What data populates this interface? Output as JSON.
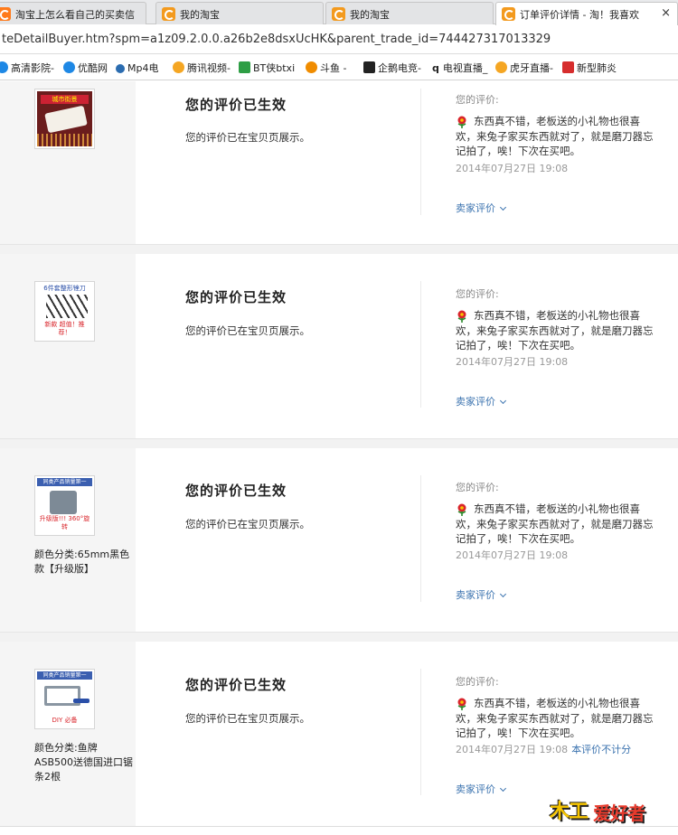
{
  "tabs": [
    {
      "label": "淘宝上怎么看自己的买卖信",
      "active": false
    },
    {
      "label": "我的淘宝",
      "active": false
    },
    {
      "label": "我的淘宝",
      "active": false
    },
    {
      "label": "订单评价详情 - 淘！我喜欢",
      "active": true,
      "close": "×"
    }
  ],
  "address": {
    "url": "teDetailBuyer.htm?spm=a1z09.2.0.0.a26b2e8dsxUcHK&parent_trade_id=744427317013329"
  },
  "bookmarks": [
    {
      "label": "高清影院-",
      "icon": "play-icon",
      "color": "#1e88e5"
    },
    {
      "label": "优酷网",
      "icon": "youku-icon",
      "color": "#1e88e5"
    },
    {
      "label": "Mp4电",
      "icon": "globe-icon",
      "color": "#2b6cb0"
    },
    {
      "label": "腾讯视频-",
      "icon": "tencent-video-icon",
      "color": "#f5a623"
    },
    {
      "label": "BT侠btxi",
      "icon": "bt-icon",
      "color": "#2e9e45"
    },
    {
      "label": "斗鱼 -",
      "icon": "douyu-icon",
      "color": "#f08c00"
    },
    {
      "label": "企鹅电竞-",
      "icon": "penguin-icon",
      "color": "#222222"
    },
    {
      "label": "电视直播_",
      "icon": "q-icon",
      "color": "#222222"
    },
    {
      "label": "虎牙直播-",
      "icon": "huya-icon",
      "color": "#f5a623"
    },
    {
      "label": "新型肺炎",
      "icon": "news-icon",
      "color": "#d62d2d"
    }
  ],
  "reviews": [
    {
      "thumb_text": "城市街景",
      "variant": "",
      "status": "您的评价已生效",
      "shown": "您的评价已在宝贝页展示。",
      "your_review_label": "您的评价:",
      "review_text": "东西真不错，老板送的小礼物也很喜欢，来兔子家买东西就对了，就是磨刀器忘记拍了，唉！下次在买吧。",
      "date": "2014年07月27日 19:08",
      "not_counted": "",
      "seller_review": "卖家评价"
    },
    {
      "thumb_text": "6件套整形锉刀",
      "thumb_sub": "新款 超值！推荐！",
      "variant": "",
      "status": "您的评价已生效",
      "shown": "您的评价已在宝贝页展示。",
      "your_review_label": "您的评价:",
      "review_text": "东西真不错，老板送的小礼物也很喜欢，来兔子家买东西就对了，就是磨刀器忘记拍了，唉！下次在买吧。",
      "date": "2014年07月27日 19:08",
      "not_counted": "",
      "seller_review": "卖家评价"
    },
    {
      "thumb_text": "同类产品销量第一",
      "thumb_sub": "升级版!!! 360°旋转",
      "variant": "颜色分类:65mm黑色款【升级版】",
      "status": "您的评价已生效",
      "shown": "您的评价已在宝贝页展示。",
      "your_review_label": "您的评价:",
      "review_text": "东西真不错，老板送的小礼物也很喜欢，来兔子家买东西就对了，就是磨刀器忘记拍了，唉！下次在买吧。",
      "date": "2014年07月27日 19:08",
      "not_counted": "",
      "seller_review": "卖家评价"
    },
    {
      "thumb_text": "同类产品销量第一",
      "thumb_sub": "DIY 必备",
      "variant": "颜色分类:鱼牌ASB500送德国进口锯条2根",
      "status": "您的评价已生效",
      "shown": "您的评价已在宝贝页展示。",
      "your_review_label": "您的评价:",
      "review_text": "东西真不错，老板送的小礼物也很喜欢，来兔子家买东西就对了，就是磨刀器忘记拍了，唉！下次在买吧。",
      "date": "2014年07月27日 19:08",
      "not_counted": "本评价不计分",
      "seller_review": "卖家评价"
    }
  ],
  "watermark": {
    "text1": "木工",
    "text2": "爱好者"
  },
  "colors": {
    "link": "#3b73af",
    "left_panel": "#f5f5f5",
    "tab_icon": "#f39a1e",
    "flower": "#d9252b"
  }
}
